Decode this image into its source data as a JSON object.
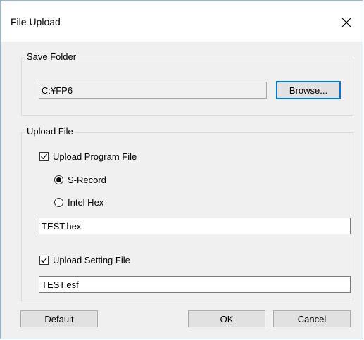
{
  "dialog": {
    "title": "File Upload",
    "close_icon": "close-icon"
  },
  "save_folder": {
    "group_label": "Save Folder",
    "path_value": "C:¥FP6",
    "browse_label": "Browse..."
  },
  "upload_file": {
    "group_label": "Upload File",
    "program_checkbox_label": "Upload Program File",
    "program_checked": true,
    "format_options": [
      {
        "label": "S-Record",
        "selected": true
      },
      {
        "label": "Intel Hex",
        "selected": false
      }
    ],
    "program_file_value": "TEST.hex",
    "setting_checkbox_label": "Upload Setting File",
    "setting_checked": true,
    "setting_file_value": "TEST.esf"
  },
  "footer": {
    "default_label": "Default",
    "ok_label": "OK",
    "cancel_label": "Cancel"
  },
  "colors": {
    "window_bg": "#f0f0f0",
    "titlebar_bg": "#ffffff",
    "focus_accent": "#0078d7",
    "window_border": "#8fb8e8"
  }
}
